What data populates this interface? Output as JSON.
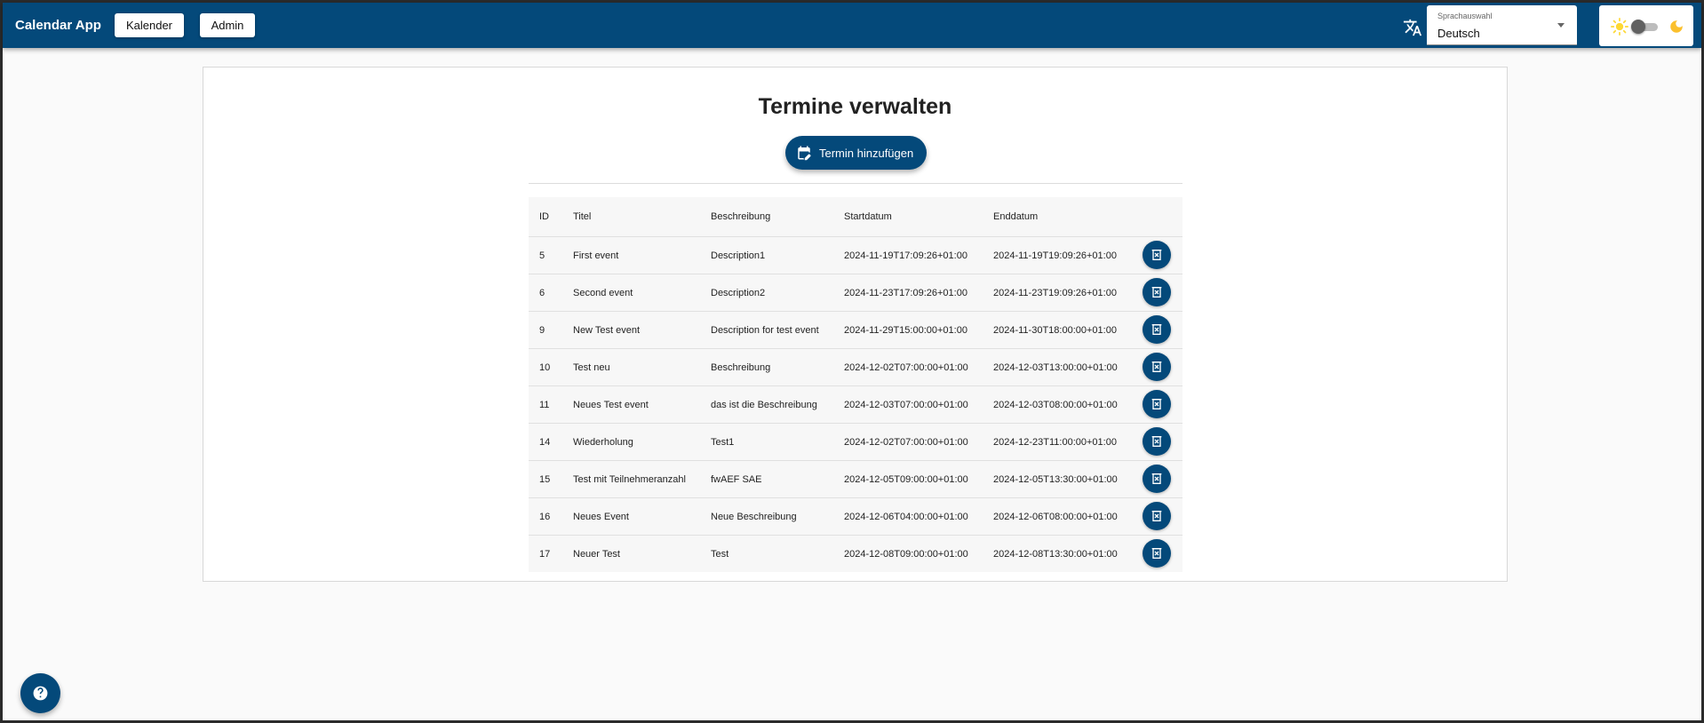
{
  "header": {
    "app_title": "Calendar App",
    "nav": [
      {
        "label": "Kalender"
      },
      {
        "label": "Admin"
      }
    ],
    "language": {
      "label": "Sprachauswahl",
      "value": "Deutsch"
    },
    "theme": {
      "sun_icon": "sun-icon",
      "moon_icon": "moon-icon",
      "dark_mode": false
    }
  },
  "main": {
    "title": "Termine verwalten",
    "add_button_label": "Termin hinzufügen",
    "table": {
      "columns": [
        "ID",
        "Titel",
        "Beschreibung",
        "Startdatum",
        "Enddatum"
      ],
      "rows": [
        {
          "id": "5",
          "title": "First event",
          "description": "Description1",
          "start": "2024-11-19T17:09:26+01:00",
          "end": "2024-11-19T19:09:26+01:00"
        },
        {
          "id": "6",
          "title": "Second event",
          "description": "Description2",
          "start": "2024-11-23T17:09:26+01:00",
          "end": "2024-11-23T19:09:26+01:00"
        },
        {
          "id": "9",
          "title": "New Test event",
          "description": "Description for test event",
          "start": "2024-11-29T15:00:00+01:00",
          "end": "2024-11-30T18:00:00+01:00"
        },
        {
          "id": "10",
          "title": "Test neu",
          "description": "Beschreibung",
          "start": "2024-12-02T07:00:00+01:00",
          "end": "2024-12-03T13:00:00+01:00"
        },
        {
          "id": "11",
          "title": "Neues Test event",
          "description": "das ist die Beschreibung",
          "start": "2024-12-03T07:00:00+01:00",
          "end": "2024-12-03T08:00:00+01:00"
        },
        {
          "id": "14",
          "title": "Wiederholung",
          "description": "Test1",
          "start": "2024-12-02T07:00:00+01:00",
          "end": "2024-12-23T11:00:00+01:00"
        },
        {
          "id": "15",
          "title": "Test mit Teilnehmeranzahl",
          "description": "fwAEF SAE",
          "start": "2024-12-05T09:00:00+01:00",
          "end": "2024-12-05T13:30:00+01:00"
        },
        {
          "id": "16",
          "title": "Neues Event",
          "description": "Neue Beschreibung",
          "start": "2024-12-06T04:00:00+01:00",
          "end": "2024-12-06T08:00:00+01:00"
        },
        {
          "id": "17",
          "title": "Neuer Test",
          "description": "Test",
          "start": "2024-12-08T09:00:00+01:00",
          "end": "2024-12-08T13:30:00+01:00"
        }
      ]
    }
  },
  "colors": {
    "primary": "#04497a",
    "sun": "#fdd835",
    "moon": "#fbc02d"
  }
}
